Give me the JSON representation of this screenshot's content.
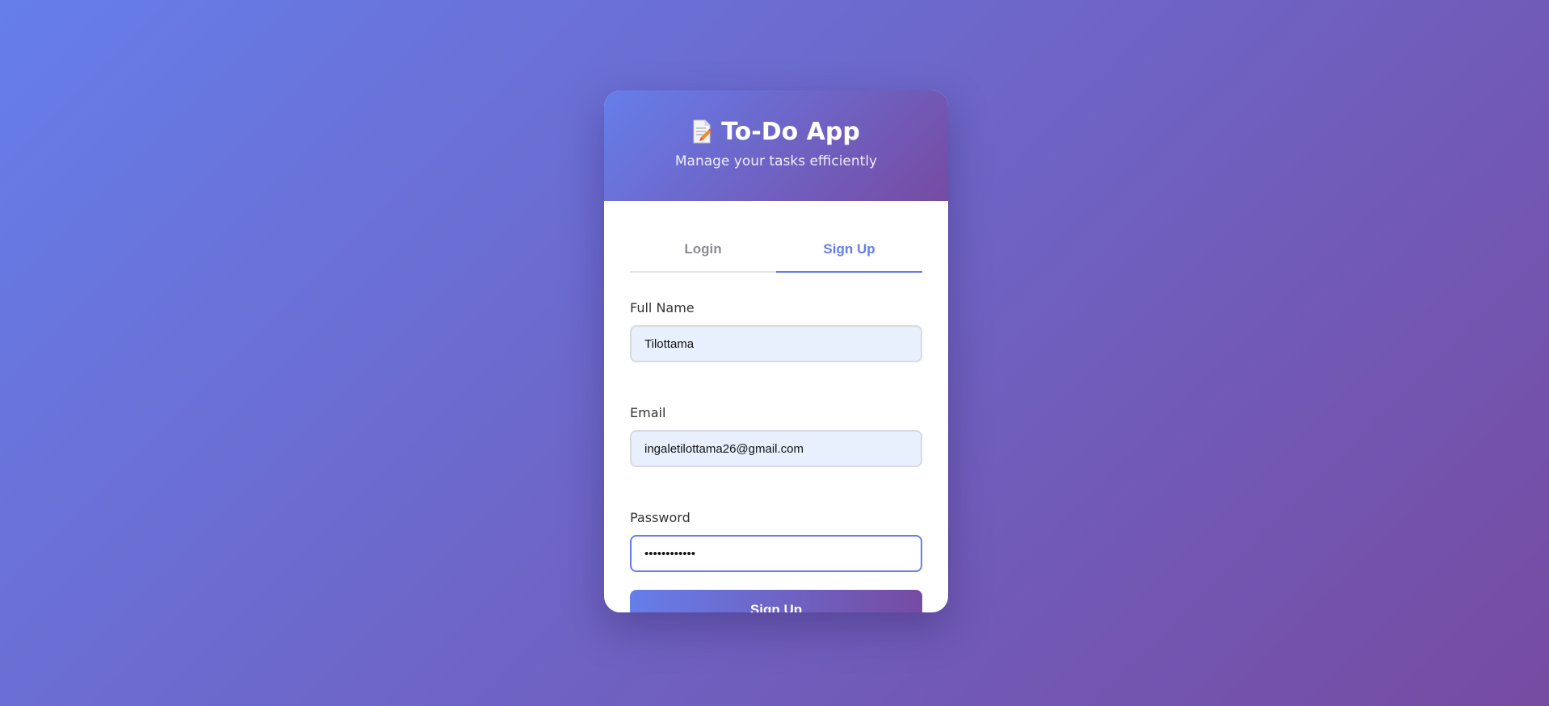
{
  "header": {
    "icon": "memo-pencil-icon",
    "title": "To-Do App",
    "subtitle": "Manage your tasks efficiently"
  },
  "tabs": [
    {
      "label": "Login",
      "active": false
    },
    {
      "label": "Sign Up",
      "active": true
    }
  ],
  "form": {
    "full_name": {
      "label": "Full Name",
      "value": "Tilottama"
    },
    "email": {
      "label": "Email",
      "value": "ingaletilottama26@gmail.com"
    },
    "password": {
      "label": "Password",
      "value": "••••••••••••"
    },
    "submit_label": "Sign Up"
  },
  "colors": {
    "accent": "#667eea",
    "accent_end": "#764ba2",
    "autofill_bg": "#e8f0fe"
  }
}
